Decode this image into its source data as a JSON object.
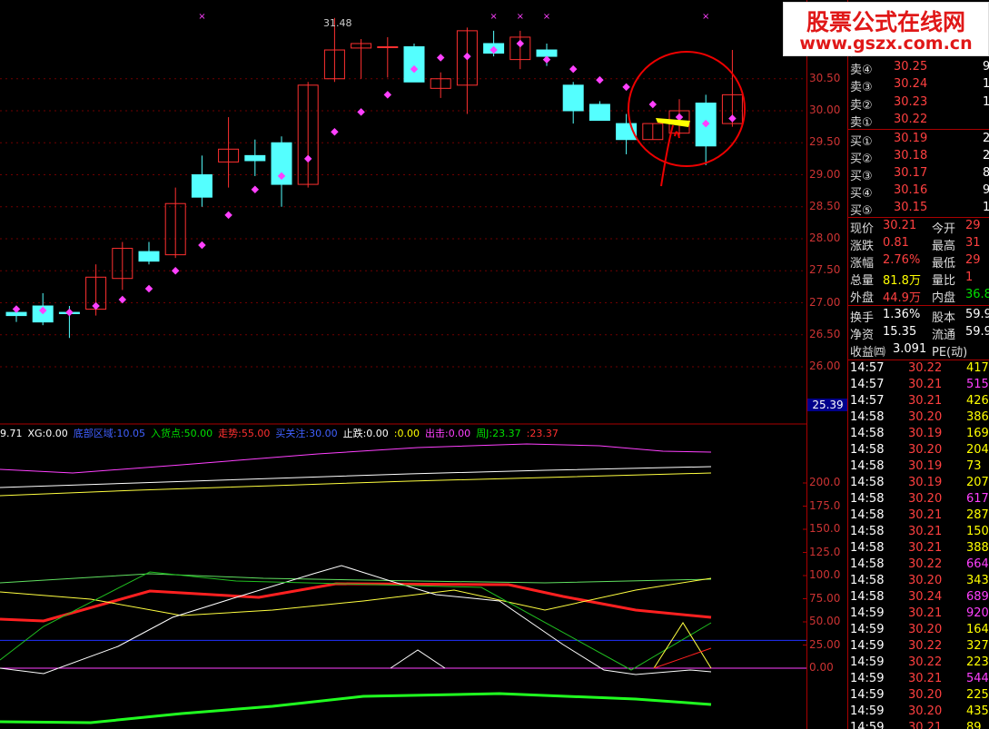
{
  "watermark": {
    "line1": "股票公式在线网",
    "line2": "www.gszx.com.cn"
  },
  "colors": {
    "up": "#ff3030",
    "down": "#54ffff",
    "dot": "#ff40ff",
    "grid": "#700000",
    "axis": "#a00000"
  },
  "chart_data": [
    {
      "type": "candlestick",
      "ylim": [
        25.39,
        31.9
      ],
      "y_ticks": [
        "30.50",
        "30.00",
        "29.50",
        "29.00",
        "28.50",
        "28.00",
        "27.50",
        "27.00",
        "26.50",
        "26.00"
      ],
      "y_tick_values": [
        30.5,
        30.0,
        29.5,
        29.0,
        28.5,
        28.0,
        27.5,
        27.0,
        26.5,
        26.0
      ],
      "price_tag": "25.39",
      "high_label": "31.48",
      "candles": [
        {
          "o": 26.85,
          "c": 26.8,
          "h": 26.95,
          "l": 26.7
        },
        {
          "o": 26.95,
          "c": 26.7,
          "h": 27.15,
          "l": 26.65
        },
        {
          "o": 26.85,
          "c": 26.83,
          "h": 26.95,
          "l": 26.45
        },
        {
          "o": 26.9,
          "c": 27.4,
          "h": 27.6,
          "l": 26.8
        },
        {
          "o": 27.38,
          "c": 27.85,
          "h": 27.95,
          "l": 27.2
        },
        {
          "o": 27.8,
          "c": 27.65,
          "h": 27.95,
          "l": 27.6
        },
        {
          "o": 27.75,
          "c": 28.55,
          "h": 28.8,
          "l": 27.7
        },
        {
          "o": 29.0,
          "c": 28.65,
          "h": 29.3,
          "l": 28.5
        },
        {
          "o": 29.2,
          "c": 29.4,
          "h": 29.9,
          "l": 28.8
        },
        {
          "o": 29.3,
          "c": 29.22,
          "h": 29.55,
          "l": 28.98
        },
        {
          "o": 29.5,
          "c": 28.85,
          "h": 29.6,
          "l": 28.5
        },
        {
          "o": 28.85,
          "c": 30.4,
          "h": 30.45,
          "l": 28.8
        },
        {
          "o": 30.5,
          "c": 30.95,
          "h": 31.45,
          "l": 30.45
        },
        {
          "o": 30.98,
          "c": 31.05,
          "h": 31.12,
          "l": 30.5
        },
        {
          "o": 31.0,
          "c": 31.0,
          "h": 31.15,
          "l": 30.52
        },
        {
          "o": 31.0,
          "c": 30.45,
          "h": 31.05,
          "l": 30.45
        },
        {
          "o": 30.35,
          "c": 30.5,
          "h": 30.6,
          "l": 30.2
        },
        {
          "o": 30.4,
          "c": 31.25,
          "h": 31.3,
          "l": 29.95
        },
        {
          "o": 31.05,
          "c": 30.9,
          "h": 31.25,
          "l": 30.85
        },
        {
          "o": 30.8,
          "c": 31.15,
          "h": 31.25,
          "l": 30.65
        },
        {
          "o": 30.95,
          "c": 30.85,
          "h": 31.05,
          "l": 30.7
        },
        {
          "o": 30.4,
          "c": 30.0,
          "h": 30.45,
          "l": 29.8
        },
        {
          "o": 30.1,
          "c": 29.85,
          "h": 30.15,
          "l": 29.85
        },
        {
          "o": 29.8,
          "c": 29.55,
          "h": 29.95,
          "l": 29.32
        },
        {
          "o": 29.55,
          "c": 29.8,
          "h": 29.8,
          "l": 29.55
        },
        {
          "o": 29.65,
          "c": 30.0,
          "h": 30.18,
          "l": 29.6
        },
        {
          "o": 30.12,
          "c": 29.45,
          "h": 30.25,
          "l": 29.15
        },
        {
          "o": 29.8,
          "c": 30.25,
          "h": 30.95,
          "l": 29.75
        }
      ],
      "dots": [
        26.9,
        26.88,
        26.85,
        26.95,
        27.05,
        27.22,
        27.5,
        27.9,
        28.37,
        28.77,
        28.98,
        29.25,
        29.67,
        29.98,
        30.25,
        30.65,
        30.83,
        30.85,
        30.95,
        31.05,
        30.8,
        30.65,
        30.48,
        30.37,
        30.1,
        29.9,
        29.8,
        29.88
      ],
      "cross_marks": [
        7,
        18,
        19,
        20,
        26
      ]
    },
    {
      "type": "line",
      "ylim": [
        0,
        200
      ],
      "y_ticks": [
        "200.0",
        "175.0",
        "150.0",
        "125.0",
        "100.0",
        "75.00",
        "50.00",
        "25.00",
        "0.00"
      ],
      "y_tick_values": [
        200,
        175,
        150,
        125,
        100,
        75,
        50,
        25,
        0
      ]
    }
  ],
  "indicator_legend": [
    {
      "text": "9.71",
      "color": "#ffffff"
    },
    {
      "text": "XG:0.00",
      "color": "#ffffff"
    },
    {
      "text": "底部区域:10.05",
      "color": "#4060ff"
    },
    {
      "text": "入货点:50.00",
      "color": "#00e000"
    },
    {
      "text": "走势:55.00",
      "color": "#ff3030"
    },
    {
      "text": "买关注:30.00",
      "color": "#4060ff"
    },
    {
      "text": "止跌:0.00",
      "color": "#ffffff"
    },
    {
      "text": ":0.00",
      "color": "#ffff00"
    },
    {
      "text": "出击:0.00",
      "color": "#ff40ff"
    },
    {
      "text": "周J:23.37",
      "color": "#00e000"
    },
    {
      "text": ":23.37",
      "color": "#ff3030"
    }
  ],
  "panel": {
    "asks": [
      {
        "label": "卖⑤",
        "price": "",
        "vol": ""
      },
      {
        "label": "卖④",
        "price": "30.25",
        "vol": "9"
      },
      {
        "label": "卖③",
        "price": "30.24",
        "vol": "15"
      },
      {
        "label": "卖②",
        "price": "30.23",
        "vol": "1"
      },
      {
        "label": "卖①",
        "price": "30.22",
        "vol": ""
      }
    ],
    "bids": [
      {
        "label": "买①",
        "price": "30.19",
        "vol": "2"
      },
      {
        "label": "买②",
        "price": "30.18",
        "vol": "2"
      },
      {
        "label": "买③",
        "price": "30.17",
        "vol": "8"
      },
      {
        "label": "买④",
        "price": "30.16",
        "vol": "9"
      },
      {
        "label": "买⑤",
        "price": "30.15",
        "vol": "1"
      }
    ],
    "stats": [
      {
        "l1": "现价",
        "v1": "30.21",
        "c1": "red",
        "l2": "今开",
        "v2": "29",
        "c2": "red"
      },
      {
        "l1": "涨跌",
        "v1": "0.81",
        "c1": "red",
        "l2": "最高",
        "v2": "31",
        "c2": "red"
      },
      {
        "l1": "涨幅",
        "v1": "2.76%",
        "c1": "red",
        "l2": "最低",
        "v2": "29",
        "c2": "red"
      },
      {
        "l1": "总量",
        "v1": "81.8万",
        "c1": "yel",
        "l2": "量比",
        "v2": "1",
        "c2": "red"
      },
      {
        "l1": "外盘",
        "v1": "44.9万",
        "c1": "red",
        "l2": "内盘",
        "v2": "36.8",
        "c2": "grn"
      }
    ],
    "stats2": [
      {
        "l1": "换手",
        "v1": "1.36%",
        "c1": "wht",
        "l2": "股本",
        "v2": "59.9",
        "c2": "wht"
      },
      {
        "l1": "净资",
        "v1": "15.35",
        "c1": "wht",
        "l2": "流通",
        "v2": "59.9",
        "c2": "wht"
      }
    ],
    "income": {
      "label": "收益㈣",
      "value": "3.091",
      "pe": "PE(动)"
    },
    "ticks": [
      {
        "t": "14:57",
        "p": "30.22",
        "v": "417",
        "c": "yel"
      },
      {
        "t": "14:57",
        "p": "30.21",
        "v": "515",
        "c": "mag"
      },
      {
        "t": "14:57",
        "p": "30.21",
        "v": "426",
        "c": "yel"
      },
      {
        "t": "14:58",
        "p": "30.20",
        "v": "386",
        "c": "yel"
      },
      {
        "t": "14:58",
        "p": "30.19",
        "v": "169",
        "c": "yel"
      },
      {
        "t": "14:58",
        "p": "30.20",
        "v": "204",
        "c": "yel"
      },
      {
        "t": "14:58",
        "p": "30.19",
        "v": "73",
        "c": "yel"
      },
      {
        "t": "14:58",
        "p": "30.19",
        "v": "207",
        "c": "yel"
      },
      {
        "t": "14:58",
        "p": "30.20",
        "v": "617",
        "c": "mag"
      },
      {
        "t": "14:58",
        "p": "30.21",
        "v": "287",
        "c": "yel"
      },
      {
        "t": "14:58",
        "p": "30.21",
        "v": "150",
        "c": "yel"
      },
      {
        "t": "14:58",
        "p": "30.21",
        "v": "388",
        "c": "yel"
      },
      {
        "t": "14:58",
        "p": "30.22",
        "v": "664",
        "c": "mag"
      },
      {
        "t": "14:58",
        "p": "30.20",
        "v": "343",
        "c": "yel"
      },
      {
        "t": "14:58",
        "p": "30.24",
        "v": "689",
        "c": "mag"
      },
      {
        "t": "14:59",
        "p": "30.21",
        "v": "920",
        "c": "mag"
      },
      {
        "t": "14:59",
        "p": "30.20",
        "v": "164",
        "c": "yel"
      },
      {
        "t": "14:59",
        "p": "30.22",
        "v": "327",
        "c": "yel"
      },
      {
        "t": "14:59",
        "p": "30.22",
        "v": "223",
        "c": "yel"
      },
      {
        "t": "14:59",
        "p": "30.21",
        "v": "544",
        "c": "mag"
      },
      {
        "t": "14:59",
        "p": "30.20",
        "v": "225",
        "c": "yel"
      },
      {
        "t": "14:59",
        "p": "30.20",
        "v": "435",
        "c": "yel"
      },
      {
        "t": "14:59",
        "p": "30.21",
        "v": "89",
        "c": "yel"
      }
    ]
  }
}
